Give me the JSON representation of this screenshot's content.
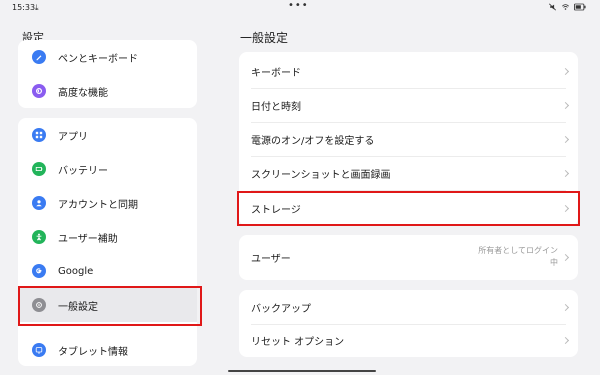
{
  "status": {
    "time": "15:33",
    "download_icon": "download-icon",
    "dots": "•••"
  },
  "left": {
    "title": "設定",
    "group1": [
      {
        "label": "ペンとキーボード",
        "icon": "pen-icon",
        "color": "#3a7bf2"
      },
      {
        "label": "高度な機能",
        "icon": "advanced-icon",
        "color": "#8a5cf0"
      }
    ],
    "group2": [
      {
        "label": "アプリ",
        "icon": "apps-icon",
        "color": "#3a7bf2"
      },
      {
        "label": "バッテリー",
        "icon": "battery-icon",
        "color": "#22b45a"
      },
      {
        "label": "アカウントと同期",
        "icon": "account-icon",
        "color": "#3a7bf2"
      },
      {
        "label": "ユーザー補助",
        "icon": "accessibility-icon",
        "color": "#22b45a"
      },
      {
        "label": "Google",
        "icon": "google-icon",
        "color": "#3a7bf2"
      },
      {
        "label": "一般設定",
        "icon": "general-settings-icon",
        "color": "#8e8e93"
      },
      {
        "label": "タブレット情報",
        "icon": "tablet-info-icon",
        "color": "#3a7bf2"
      }
    ]
  },
  "right": {
    "title": "一般設定",
    "group1": [
      {
        "label": "キーボード"
      },
      {
        "label": "日付と時刻"
      },
      {
        "label": "電源のオン/オフを設定する"
      },
      {
        "label": "スクリーンショットと画面録画"
      },
      {
        "label": "ストレージ"
      }
    ],
    "user": {
      "label": "ユーザー",
      "value_line1": "所有者としてログイン",
      "value_line2": "中"
    },
    "group3": [
      {
        "label": "バックアップ"
      },
      {
        "label": "リセット オプション"
      }
    ]
  },
  "colors": {
    "highlight": "#e01818",
    "selected_bg": "#e9e9ec"
  }
}
